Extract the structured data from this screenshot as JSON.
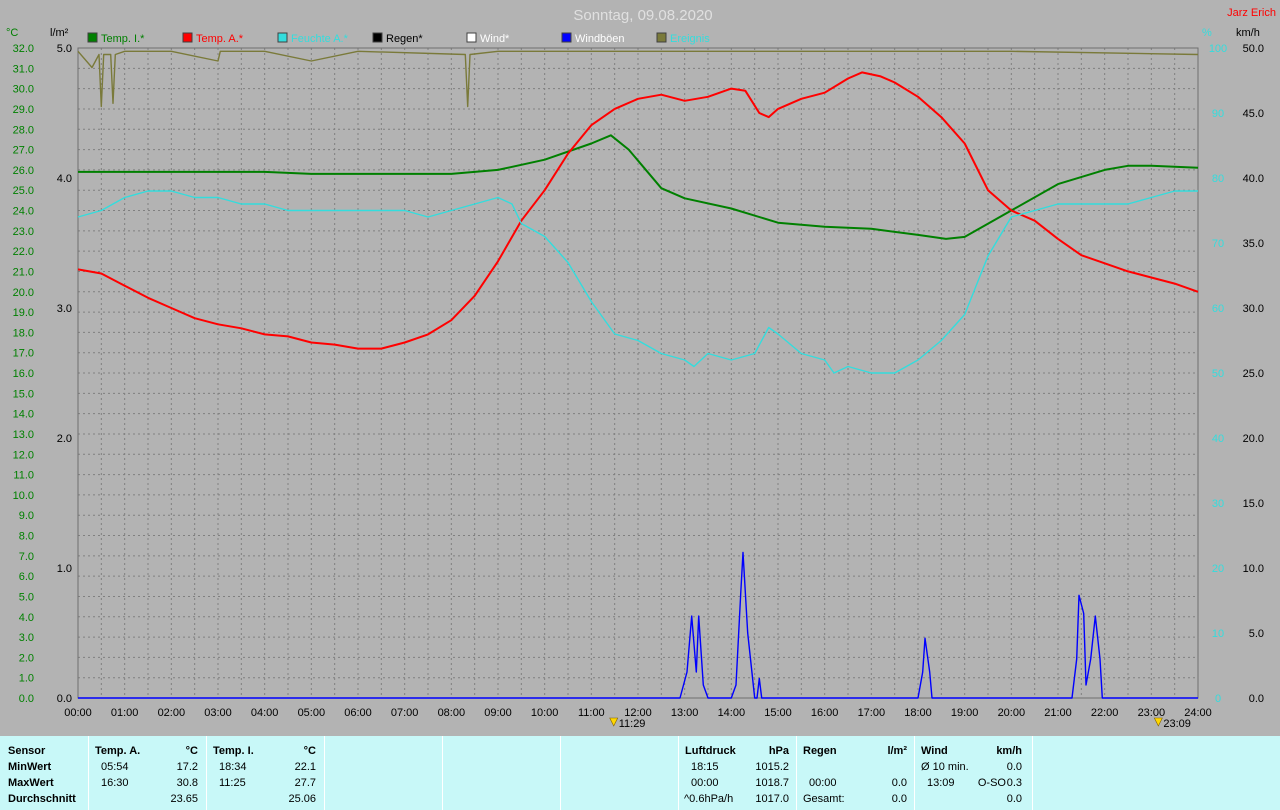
{
  "header": {
    "title": "Sonntag, 09.08.2020",
    "author": "Jarz Erich"
  },
  "colors": {
    "temp_in": "#008000",
    "temp_out": "#ff0000",
    "humidity": "#33dddd",
    "rain": "#000000",
    "wind": "#ffffff",
    "gusts": "#0000ff",
    "pressure": "#7a7a3a",
    "grid": "#808080",
    "panel": "#c8f8f8"
  },
  "chart_data": {
    "type": "line",
    "axes": {
      "temp": {
        "label": "°C",
        "range": [
          0,
          32
        ],
        "step": 1,
        "color": "#008000"
      },
      "rain": {
        "label": "l/m²",
        "range": [
          0,
          5
        ],
        "step": 1
      },
      "humidity": {
        "label": "%",
        "range": [
          0,
          100
        ],
        "step": 10,
        "color": "#33dddd"
      },
      "wind": {
        "label": "km/h",
        "range": [
          0,
          50
        ],
        "step": 5
      }
    },
    "x": {
      "range": [
        0,
        24
      ],
      "ticks": [
        "00:00",
        "01:00",
        "02:00",
        "03:00",
        "04:00",
        "05:00",
        "06:00",
        "07:00",
        "08:00",
        "09:00",
        "10:00",
        "11:00",
        "12:00",
        "13:00",
        "14:00",
        "15:00",
        "16:00",
        "17:00",
        "18:00",
        "19:00",
        "20:00",
        "21:00",
        "22:00",
        "23:00",
        "24:00"
      ]
    },
    "markers": [
      {
        "x": 11.48,
        "label": "11:29"
      },
      {
        "x": 23.15,
        "label": "23:09"
      }
    ],
    "series": [
      {
        "name": "Temp. I.*",
        "axis": "temp",
        "color": "#008000",
        "points": [
          [
            0,
            25.9
          ],
          [
            4,
            25.9
          ],
          [
            5,
            25.8
          ],
          [
            8,
            25.8
          ],
          [
            9,
            26.0
          ],
          [
            10,
            26.5
          ],
          [
            11,
            27.3
          ],
          [
            11.42,
            27.7
          ],
          [
            11.8,
            27.0
          ],
          [
            12.5,
            25.1
          ],
          [
            13,
            24.6
          ],
          [
            14,
            24.1
          ],
          [
            15,
            23.4
          ],
          [
            16,
            23.2
          ],
          [
            17,
            23.1
          ],
          [
            18,
            22.8
          ],
          [
            18.6,
            22.6
          ],
          [
            19,
            22.7
          ],
          [
            20,
            24.0
          ],
          [
            21,
            25.3
          ],
          [
            22,
            26.0
          ],
          [
            22.5,
            26.2
          ],
          [
            23,
            26.2
          ],
          [
            24,
            26.1
          ]
        ]
      },
      {
        "name": "Temp. A.*",
        "axis": "temp",
        "color": "#ff0000",
        "points": [
          [
            0,
            21.1
          ],
          [
            0.5,
            20.9
          ],
          [
            1,
            20.3
          ],
          [
            1.5,
            19.7
          ],
          [
            2,
            19.2
          ],
          [
            2.5,
            18.7
          ],
          [
            3,
            18.4
          ],
          [
            3.5,
            18.2
          ],
          [
            4,
            17.9
          ],
          [
            4.5,
            17.8
          ],
          [
            5,
            17.5
          ],
          [
            5.5,
            17.4
          ],
          [
            6,
            17.2
          ],
          [
            6.5,
            17.2
          ],
          [
            7,
            17.5
          ],
          [
            7.5,
            17.9
          ],
          [
            8,
            18.6
          ],
          [
            8.5,
            19.8
          ],
          [
            9,
            21.5
          ],
          [
            9.5,
            23.5
          ],
          [
            10,
            25.0
          ],
          [
            10.5,
            26.8
          ],
          [
            11,
            28.2
          ],
          [
            11.5,
            29.0
          ],
          [
            12,
            29.5
          ],
          [
            12.5,
            29.7
          ],
          [
            13,
            29.4
          ],
          [
            13.5,
            29.6
          ],
          [
            14,
            30.0
          ],
          [
            14.3,
            29.9
          ],
          [
            14.6,
            28.8
          ],
          [
            14.8,
            28.6
          ],
          [
            15,
            29.0
          ],
          [
            15.5,
            29.5
          ],
          [
            16,
            29.8
          ],
          [
            16.5,
            30.5
          ],
          [
            16.8,
            30.8
          ],
          [
            17.2,
            30.6
          ],
          [
            17.5,
            30.3
          ],
          [
            18,
            29.6
          ],
          [
            18.5,
            28.6
          ],
          [
            19,
            27.3
          ],
          [
            19.5,
            25.0
          ],
          [
            20,
            24.0
          ],
          [
            20.5,
            23.5
          ],
          [
            21,
            22.6
          ],
          [
            21.5,
            21.8
          ],
          [
            22,
            21.4
          ],
          [
            22.5,
            21.0
          ],
          [
            23,
            20.7
          ],
          [
            23.5,
            20.4
          ],
          [
            24,
            20.0
          ]
        ]
      },
      {
        "name": "Feuchte A.*",
        "axis": "humidity",
        "color": "#33dddd",
        "points": [
          [
            0,
            74
          ],
          [
            0.5,
            75
          ],
          [
            1,
            77
          ],
          [
            1.5,
            78
          ],
          [
            2,
            78
          ],
          [
            2.5,
            77
          ],
          [
            3,
            77
          ],
          [
            3.5,
            76
          ],
          [
            4,
            76
          ],
          [
            4.5,
            75
          ],
          [
            5,
            75
          ],
          [
            5.5,
            75
          ],
          [
            6,
            75
          ],
          [
            6.5,
            75
          ],
          [
            7,
            75
          ],
          [
            7.5,
            74
          ],
          [
            8,
            75
          ],
          [
            8.5,
            76
          ],
          [
            9,
            77
          ],
          [
            9.3,
            76
          ],
          [
            9.5,
            73
          ],
          [
            10,
            71
          ],
          [
            10.5,
            67
          ],
          [
            11,
            61
          ],
          [
            11.5,
            56
          ],
          [
            12,
            55
          ],
          [
            12.5,
            53
          ],
          [
            13,
            52
          ],
          [
            13.2,
            51
          ],
          [
            13.5,
            53
          ],
          [
            14,
            52
          ],
          [
            14.5,
            53
          ],
          [
            14.8,
            57
          ],
          [
            15,
            56
          ],
          [
            15.5,
            53
          ],
          [
            16,
            52
          ],
          [
            16.2,
            50
          ],
          [
            16.5,
            51
          ],
          [
            17,
            50
          ],
          [
            17.5,
            50
          ],
          [
            18,
            52
          ],
          [
            18.5,
            55
          ],
          [
            19,
            59
          ],
          [
            19.5,
            68
          ],
          [
            20,
            74
          ],
          [
            20.5,
            75
          ],
          [
            21,
            76
          ],
          [
            21.5,
            76
          ],
          [
            22,
            76
          ],
          [
            22.5,
            76
          ],
          [
            23,
            77
          ],
          [
            23.5,
            78
          ],
          [
            24,
            78
          ]
        ]
      },
      {
        "name": "Windböen",
        "axis": "wind",
        "color": "#0000ff",
        "points": [
          [
            0,
            0
          ],
          [
            12.9,
            0
          ],
          [
            13.05,
            2
          ],
          [
            13.15,
            6.3
          ],
          [
            13.25,
            2
          ],
          [
            13.3,
            6.3
          ],
          [
            13.4,
            1
          ],
          [
            13.5,
            0
          ],
          [
            14.0,
            0
          ],
          [
            14.1,
            1
          ],
          [
            14.2,
            8
          ],
          [
            14.25,
            11.2
          ],
          [
            14.35,
            5
          ],
          [
            14.5,
            0
          ],
          [
            14.55,
            0
          ],
          [
            14.6,
            1.5
          ],
          [
            14.65,
            0
          ],
          [
            18.0,
            0
          ],
          [
            18.1,
            2
          ],
          [
            18.15,
            4.6
          ],
          [
            18.25,
            2
          ],
          [
            18.3,
            0
          ],
          [
            21.3,
            0
          ],
          [
            21.4,
            3
          ],
          [
            21.45,
            7.9
          ],
          [
            21.55,
            6.5
          ],
          [
            21.6,
            1
          ],
          [
            21.7,
            3
          ],
          [
            21.8,
            6.3
          ],
          [
            21.9,
            3
          ],
          [
            21.95,
            0
          ],
          [
            24,
            0
          ]
        ]
      },
      {
        "name": "Luftdruck",
        "axis": "humidity",
        "color": "#7a7a3a",
        "points": [
          [
            0,
            99.5
          ],
          [
            0.3,
            97
          ],
          [
            0.45,
            99
          ],
          [
            0.5,
            91
          ],
          [
            0.55,
            99
          ],
          [
            0.7,
            99
          ],
          [
            0.75,
            91.5
          ],
          [
            0.8,
            99
          ],
          [
            1,
            99.5
          ],
          [
            2,
            99.5
          ],
          [
            3,
            98
          ],
          [
            3.05,
            99.5
          ],
          [
            4,
            99.5
          ],
          [
            5,
            98
          ],
          [
            6,
            99.5
          ],
          [
            8.3,
            99
          ],
          [
            8.35,
            91
          ],
          [
            8.4,
            99
          ],
          [
            9,
            99.5
          ],
          [
            12,
            99.5
          ],
          [
            16,
            99.5
          ],
          [
            20,
            99.5
          ],
          [
            24,
            99
          ]
        ]
      }
    ]
  },
  "legend": [
    {
      "label": "Temp. I.*",
      "color": "#008000",
      "text_color": "#008000"
    },
    {
      "label": "Temp. A.*",
      "color": "#ff0000",
      "text_color": "#ff0000"
    },
    {
      "label": "Feuchte A.*",
      "color": "#33dddd",
      "text_color": "#33dddd"
    },
    {
      "label": "Regen*",
      "color": "#000000",
      "text_color": "#000000"
    },
    {
      "label": "Wind*",
      "color": "#ffffff",
      "text_color": "#ffffff"
    },
    {
      "label": "Windböen",
      "color": "#0000ff",
      "text_color": "#ffffff"
    },
    {
      "label": "Ereignis",
      "color": "#7a7a3a",
      "text_color": "#33dddd"
    }
  ],
  "stats": {
    "sensor": {
      "header": "Sensor",
      "min": "MinWert",
      "max": "MaxWert",
      "avg": "Durchschnitt"
    },
    "temp_a": {
      "header": "Temp. A.",
      "unit": "°C",
      "min_time": "05:54",
      "min_val": "17.2",
      "max_time": "16:30",
      "max_val": "30.8",
      "avg_val": "23.65"
    },
    "temp_i": {
      "header": "Temp. I.",
      "unit": "°C",
      "min_time": "18:34",
      "min_val": "22.1",
      "max_time": "11:25",
      "max_val": "27.7",
      "avg_val": "25.06"
    },
    "pressure": {
      "header": "Luftdruck",
      "unit": "hPa",
      "min_time": "18:15",
      "min_val": "1015.2",
      "max_time": "00:00",
      "max_val": "1018.7",
      "trend": "^0.6hPa/h",
      "avg_val": "1017.0"
    },
    "rain": {
      "header": "Regen",
      "unit": "l/m²",
      "max_time": "00:00",
      "max_val": "0.0",
      "min_val": "0.0",
      "total_label": "Gesamt:",
      "total_val": "0.0"
    },
    "wind": {
      "header": "Wind",
      "unit": "km/h",
      "avg_label": "Ø 10 min.",
      "avg_val": "0.0",
      "max_time": "13:09",
      "max_dir": "O-SO",
      "max_val": "0.3",
      "avg_day": "0.0"
    }
  }
}
